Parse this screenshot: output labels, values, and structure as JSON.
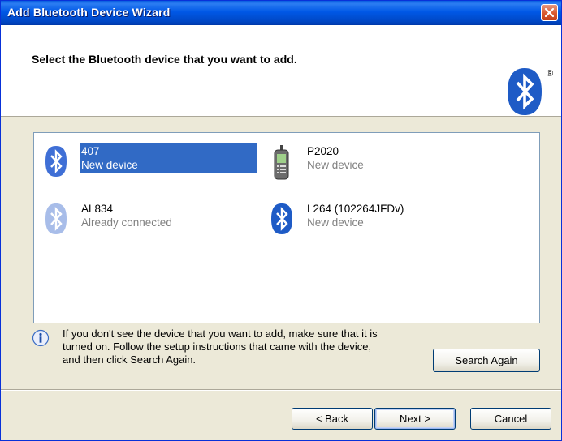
{
  "window": {
    "title": "Add Bluetooth Device Wizard"
  },
  "header": {
    "text": "Select the Bluetooth device that you want to add.",
    "reg_mark": "®"
  },
  "devices": [
    {
      "name": "407",
      "status": "New device",
      "icon": "bluetooth-icon",
      "selected": true
    },
    {
      "name": "P2020",
      "status": "New device",
      "icon": "mobile-phone-icon",
      "selected": false
    },
    {
      "name": "AL834",
      "status": "Already connected",
      "icon": "bluetooth-faded-icon",
      "selected": false
    },
    {
      "name": "L264 (102264JFDv)",
      "status": "New device",
      "icon": "bluetooth-icon",
      "selected": false
    }
  ],
  "info": {
    "line1": "If you don't see the device that you want to add, make sure that it is",
    "line2": "turned on. Follow the setup instructions that came with the device,",
    "line3": "and then click Search Again."
  },
  "buttons": {
    "search_again": "Search Again",
    "back": "< Back",
    "next": "Next >",
    "cancel": "Cancel"
  },
  "colors": {
    "title_bar": "#0058e6",
    "selection": "#316ac5",
    "bluetooth_blue": "#1e5bc6",
    "dialog_bg": "#ece9d8"
  }
}
